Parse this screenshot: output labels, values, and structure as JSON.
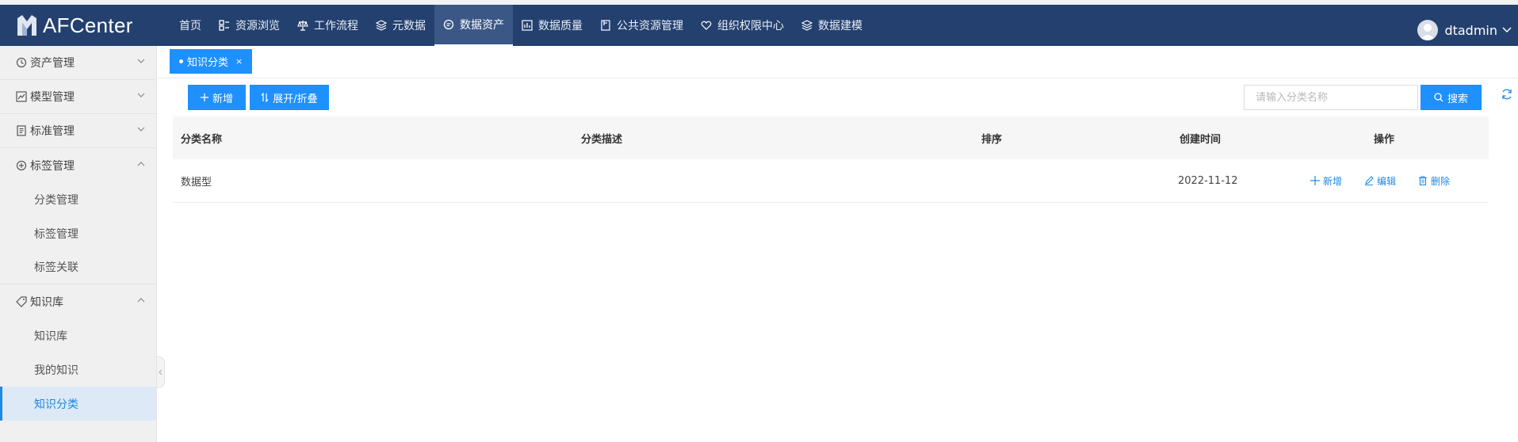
{
  "app": {
    "title": "AFCenter"
  },
  "nav": {
    "items": [
      {
        "label": "首页",
        "icon": ""
      },
      {
        "label": "资源浏览",
        "icon": "grid-icon"
      },
      {
        "label": "工作流程",
        "icon": "scale-icon"
      },
      {
        "label": "元数据",
        "icon": "layers-icon"
      },
      {
        "label": "数据资产",
        "icon": "asset-icon",
        "active": true
      },
      {
        "label": "数据质量",
        "icon": "chart-icon"
      },
      {
        "label": "公共资源管理",
        "icon": "book-icon"
      },
      {
        "label": "组织权限中心",
        "icon": "heart-icon"
      },
      {
        "label": "数据建模",
        "icon": "layers-icon"
      }
    ]
  },
  "user": {
    "name": "dtadmin"
  },
  "sidebar": {
    "groups": [
      {
        "label": "资产管理",
        "icon": "clock-icon",
        "expanded": false
      },
      {
        "label": "模型管理",
        "icon": "trend-icon",
        "expanded": false
      },
      {
        "label": "标准管理",
        "icon": "doc-icon",
        "expanded": false
      },
      {
        "label": "标签管理",
        "icon": "plus-circle-icon",
        "expanded": true,
        "children": [
          "分类管理",
          "标签管理",
          "标签关联"
        ]
      },
      {
        "label": "知识库",
        "icon": "tag-icon",
        "expanded": true,
        "children": [
          "知识库",
          "我的知识",
          "知识分类"
        ]
      }
    ],
    "active_item": "知识分类"
  },
  "tabs": {
    "active": {
      "label": "知识分类",
      "close": "×"
    }
  },
  "toolbar": {
    "add_label": "新增",
    "toggle_label": "展开/折叠",
    "search_placeholder": "请输入分类名称",
    "search_value": "",
    "search_label": "搜索"
  },
  "table": {
    "columns": [
      "分类名称",
      "分类描述",
      "排序",
      "创建时间",
      "操作"
    ],
    "rows": [
      {
        "name": "数据型",
        "description": "",
        "order": "",
        "created": "2022-11-12"
      }
    ],
    "actions": {
      "add": "新增",
      "edit": "编辑",
      "delete": "删除"
    }
  },
  "colors": {
    "primary": "#1e90ff",
    "topbar": "#24406e",
    "sidebar": "#f0f0f0"
  }
}
